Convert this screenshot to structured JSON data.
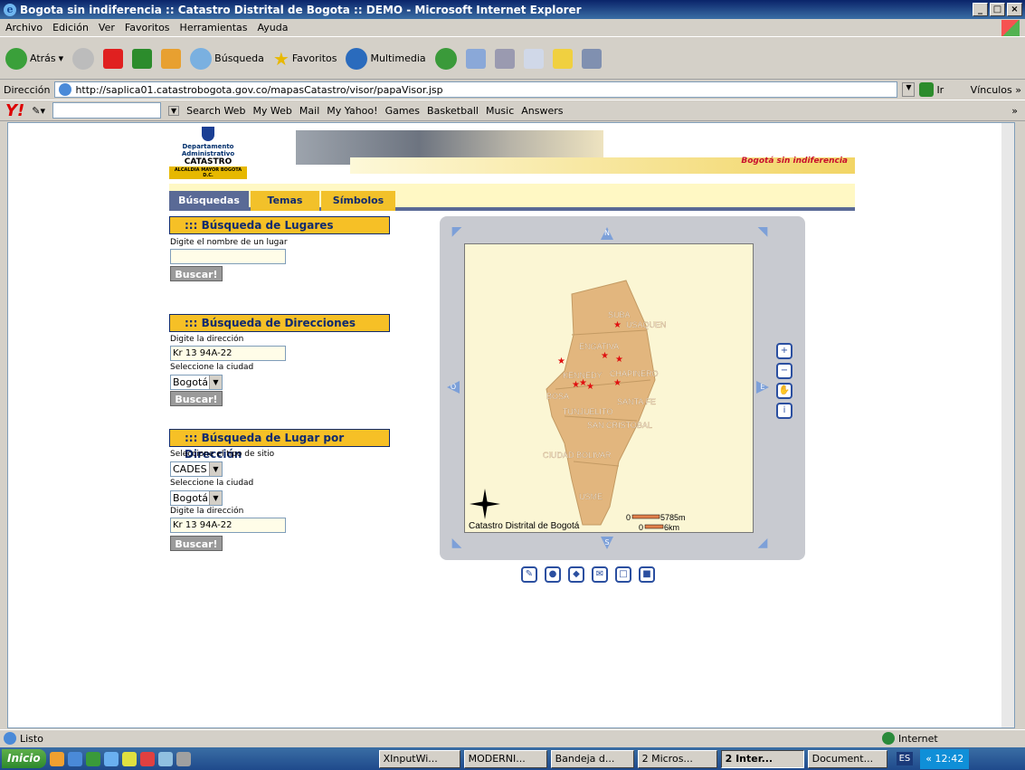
{
  "window": {
    "title": "Bogota sin indiferencia :: Catastro Distrital de Bogota :: DEMO - Microsoft Internet Explorer"
  },
  "menu": [
    "Archivo",
    "Edición",
    "Ver",
    "Favoritos",
    "Herramientas",
    "Ayuda"
  ],
  "toolbar": {
    "back": "Atrás",
    "search": "Búsqueda",
    "favorites": "Favoritos",
    "media": "Multimedia"
  },
  "address": {
    "label": "Dirección",
    "url": "http://saplica01.catastrobogota.gov.co/mapasCatastro/visor/papaVisor.jsp",
    "go": "Ir",
    "links": "Vínculos"
  },
  "yahoo": {
    "search_web": "Search Web",
    "items": [
      "My Web",
      "Mail",
      "My Yahoo!",
      "Games",
      "Basketball",
      "Music",
      "Answers"
    ]
  },
  "banner": {
    "dept": "Departamento Administrativo",
    "catastro": "CATASTRO",
    "alcaldia": "ALCALDIA MAYOR BOGOTA D.C.",
    "slogan": "Bogotá sin indiferencia"
  },
  "tabs": [
    "Búsquedas",
    "Temas",
    "Símbolos"
  ],
  "lugares": {
    "title": "::: Búsqueda de Lugares",
    "label": "Digite el nombre de un lugar",
    "value": "",
    "button": "Buscar!"
  },
  "direcciones": {
    "title": "::: Búsqueda de Direcciones",
    "label": "Digite la dirección",
    "value": "Kr 13 94A-22",
    "city_label": "Seleccione la ciudad",
    "city": "Bogotá",
    "button": "Buscar!"
  },
  "lugar_dir": {
    "title": "::: Búsqueda de Lugar por Dirección",
    "type_label": "Seleccione el tipo de sitio",
    "type": "CADES",
    "city_label": "Seleccione la ciudad",
    "city": "Bogotá",
    "addr_label": "Digite la dirección",
    "addr": "Kr 13 94A-22",
    "button": "Buscar!"
  },
  "map": {
    "compass": {
      "n": "N",
      "s": "S",
      "e": "E",
      "o": "O"
    },
    "localities": [
      "SUBA",
      "USAQUEN",
      "ENGATIVA",
      "KENNEDY",
      "CHAPINERO",
      "BOSA",
      "SANTA FE",
      "TUNJUELITO",
      "SAN CRISTOBAL",
      "CIUDAD BOLIVAR",
      "USME"
    ],
    "scale1": "5785m",
    "scale2": "6km",
    "scale_zero": "0",
    "credit": "Catastro Distrital de Bogotá"
  },
  "status": {
    "text": "Listo",
    "zone": "Internet"
  },
  "taskbar": {
    "start": "Inicio",
    "tasks": [
      "XInputWi...",
      "MODERNI...",
      "Bandeja d...",
      "2 Micros...",
      "2 Inter...",
      "Document..."
    ],
    "lang": "ES",
    "time": "12:42"
  },
  "colors": {
    "title": "#0a246a",
    "tabbar": "#fff8c4",
    "panel": "#f6c026",
    "navy": "#0f2a6e",
    "map_bg": "#fbf6d4",
    "terrain": "#e2b67e"
  }
}
